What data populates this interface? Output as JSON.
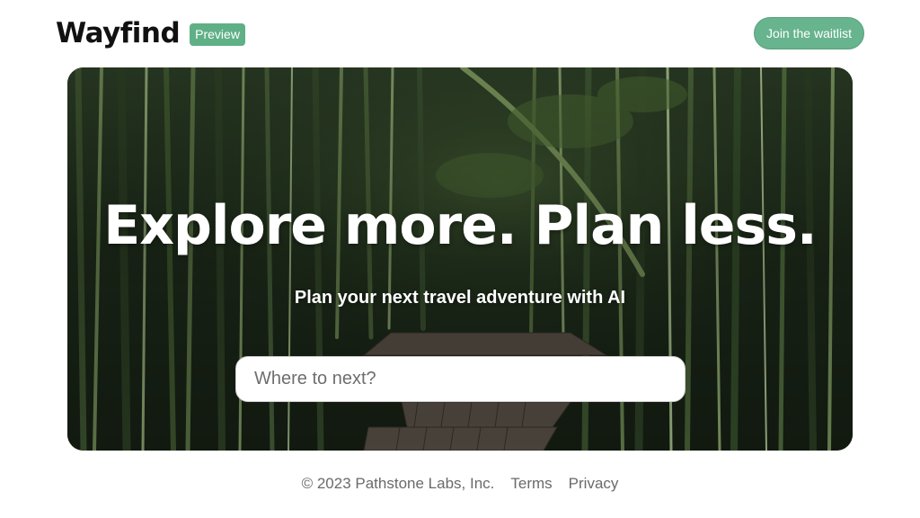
{
  "header": {
    "brand": "Wayfind",
    "badge": "Preview",
    "waitlist_label": "Join the waitlist"
  },
  "hero": {
    "title": "Explore more. Plan less.",
    "subtitle": "Plan your next travel adventure with AI",
    "background_image": "bamboo forest with wooden boardwalk"
  },
  "search": {
    "placeholder": "Where to next?",
    "value": ""
  },
  "footer": {
    "copyright": "© 2023 Pathstone Labs, Inc.",
    "links": [
      "Terms",
      "Privacy"
    ]
  },
  "colors": {
    "accent": "#67b48e",
    "badge": "#5fb087",
    "text_dark": "#111111",
    "text_muted": "#6a6a6a"
  }
}
